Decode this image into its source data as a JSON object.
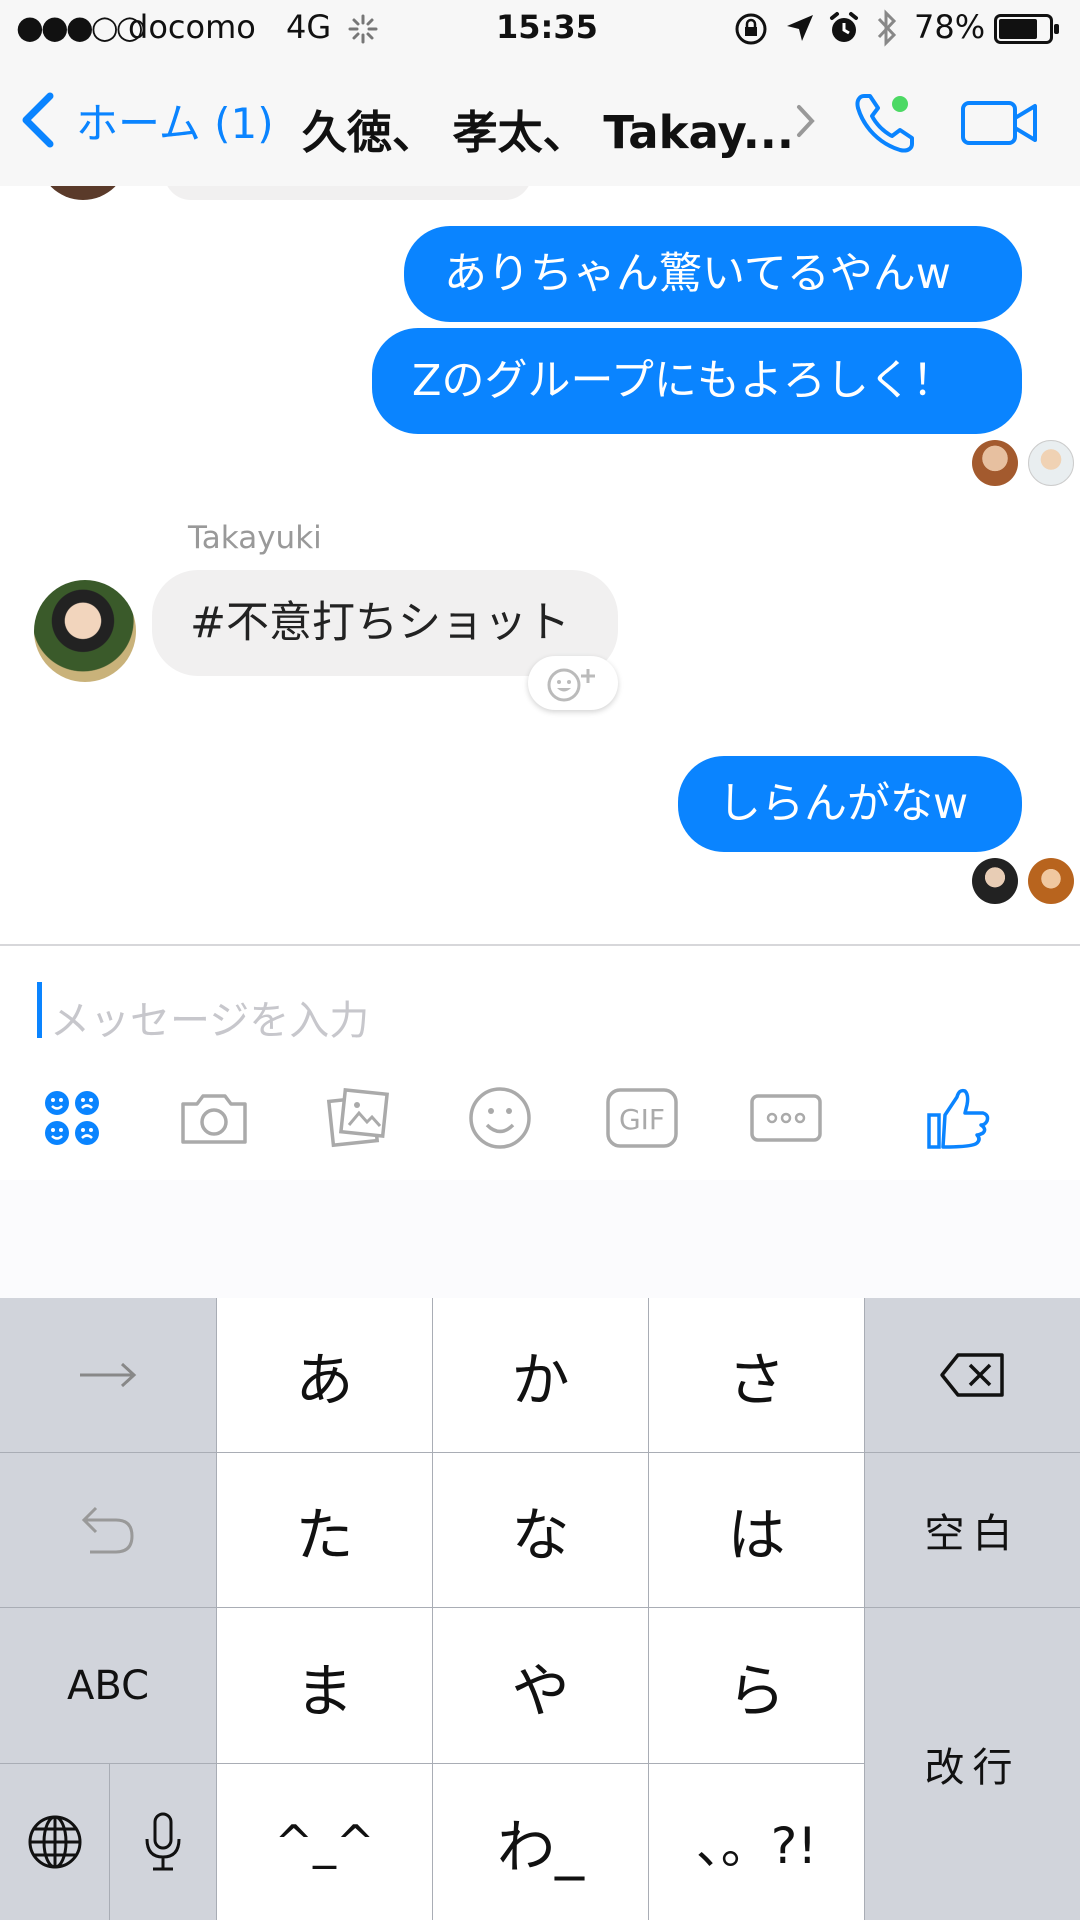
{
  "status_bar": {
    "signal": "●●●○○",
    "carrier": "docomo",
    "network": "4G",
    "time": "15:35",
    "battery_percent": "78%",
    "battery_level": 0.78
  },
  "nav": {
    "back_label": "ホーム (1)",
    "title": "久徳、 孝太、 Takay..."
  },
  "messages": {
    "out1": "ありちゃん驚いてるやんw",
    "out2": "Zのグループにもよろしく！",
    "sender_name": "Takayuki",
    "in1": "#不意打ちショット",
    "out3": "しらんがなw"
  },
  "composer": {
    "placeholder": "メッセージを入力",
    "tools": [
      "emoji-faces-icon",
      "camera-icon",
      "photo-gallery-icon",
      "smiley-icon",
      "gif-icon",
      "more-icon",
      "like-thumb-icon"
    ]
  },
  "keyboard": {
    "arrow": "→",
    "a": "あ",
    "ka": "か",
    "sa": "さ",
    "ta": "た",
    "na": "な",
    "ha": "は",
    "space": "空白",
    "abc": "ABC",
    "ma": "ま",
    "ya": "や",
    "ra": "ら",
    "return": "改行",
    "kaomoji": "^_^",
    "wa": "わ_",
    "punct": "、。?!"
  },
  "colors": {
    "accent": "#0a84ff",
    "incoming_bubble": "#f1f0f0",
    "online_dot": "#4cd964"
  }
}
